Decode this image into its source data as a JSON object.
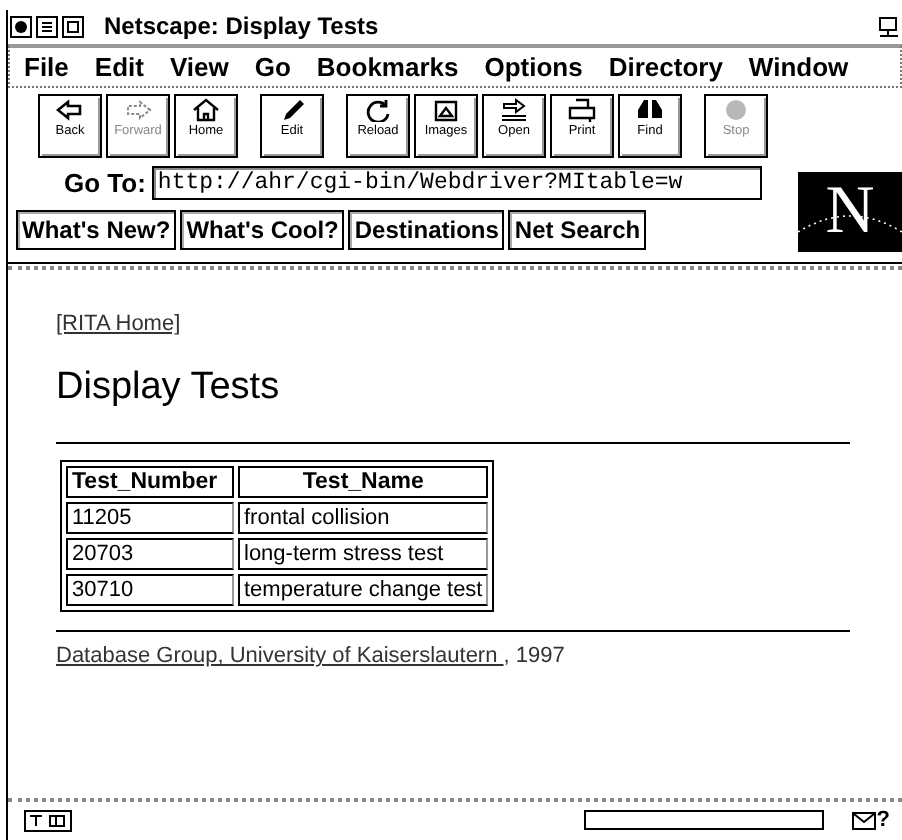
{
  "window": {
    "title": "Netscape: Display Tests"
  },
  "menu": [
    "File",
    "Edit",
    "View",
    "Go",
    "Bookmarks",
    "Options",
    "Directory",
    "Window"
  ],
  "toolbar": [
    {
      "label": "Back",
      "disabled": false
    },
    {
      "label": "Forward",
      "disabled": true
    },
    {
      "label": "Home",
      "disabled": false
    },
    {
      "label": "Edit",
      "disabled": false
    },
    {
      "label": "Reload",
      "disabled": false
    },
    {
      "label": "Images",
      "disabled": false
    },
    {
      "label": "Open",
      "disabled": false
    },
    {
      "label": "Print",
      "disabled": false
    },
    {
      "label": "Find",
      "disabled": false
    },
    {
      "label": "Stop",
      "disabled": true
    }
  ],
  "location": {
    "label": "Go To:",
    "value": "http://ahr/cgi-bin/Webdriver?MItable=w"
  },
  "logo": "N",
  "directory_buttons": [
    "What's New?",
    "What's Cool?",
    "Destinations",
    "Net Search"
  ],
  "page": {
    "link": "[RITA Home]",
    "heading": "Display Tests",
    "table": {
      "columns": [
        "Test_Number",
        "Test_Name"
      ],
      "rows": [
        [
          "11205",
          "frontal collision"
        ],
        [
          "20703",
          "long-term stress test"
        ],
        [
          "30710",
          "temperature change test"
        ]
      ]
    },
    "footer_link": "Database Group, University of Kaiserslautern ",
    "footer_text": ", 1997"
  },
  "status_bar": {
    "mail_mark": "?"
  }
}
